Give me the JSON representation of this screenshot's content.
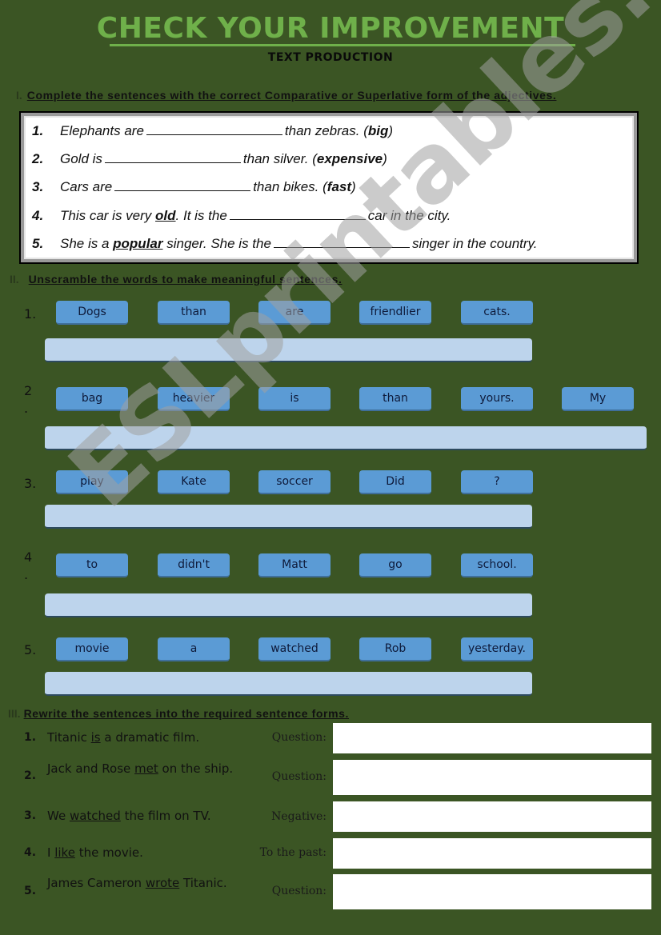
{
  "header": {
    "title": "CHECK YOUR IMPROVEMENT",
    "subtitle": "TEXT PRODUCTION"
  },
  "section1": {
    "number": "I.",
    "instruction": "Complete the sentences with the correct Comparative or Superlative form of the adjectives.",
    "items": [
      {
        "num": "1.",
        "before": "Elephants are",
        "after": "than zebras. (",
        "hint": "big",
        "close": ")"
      },
      {
        "num": "2.",
        "before": "Gold is",
        "after": "than silver. (",
        "hint": "expensive",
        "close": ")"
      },
      {
        "num": "3.",
        "before": "Cars are",
        "after": "than bikes. (",
        "hint": "fast",
        "close": ")"
      },
      {
        "num": "4.",
        "pre": "This car is very ",
        "keyword": "old",
        "before": ". It is the",
        "after": "car in the city."
      },
      {
        "num": "5.",
        "pre": "She is a ",
        "keyword": "popular",
        "before": " singer. She is the",
        "after": "singer in the country."
      }
    ]
  },
  "section2": {
    "number": "II.",
    "instruction": "Unscramble the words to make meaningful sentences.",
    "items": [
      {
        "num": "1.",
        "words": [
          "Dogs",
          "than",
          "are",
          "friendlier",
          "cats."
        ]
      },
      {
        "num": "2\n.",
        "words": [
          "bag",
          "heavier",
          "is",
          "than",
          "yours.",
          "My"
        ]
      },
      {
        "num": "3.",
        "words": [
          "play",
          "Kate",
          "soccer",
          "Did",
          "?"
        ]
      },
      {
        "num": "4\n.",
        "words": [
          "to",
          "didn't",
          "Matt",
          "go",
          "school."
        ]
      },
      {
        "num": "5.",
        "words": [
          "movie",
          "a",
          "watched",
          "Rob",
          "yesterday."
        ]
      }
    ]
  },
  "section3": {
    "number": "III.",
    "instruction": "Rewrite the sentences into the required sentence forms.",
    "items": [
      {
        "num": "1.",
        "pre": "Titanic ",
        "keyword": "is",
        "post": " a dramatic film.",
        "label": "Question:"
      },
      {
        "num": "2.",
        "pre": "Jack and Rose ",
        "keyword": "met",
        "post": " on the ship.",
        "label": "Question:"
      },
      {
        "num": "3.",
        "pre": "We ",
        "keyword": "watched",
        "post": " the film on TV.",
        "label": "Negative:"
      },
      {
        "num": "4.",
        "pre": "I ",
        "keyword": "like",
        "post": " the movie.",
        "label": "To the past:"
      },
      {
        "num": "5.",
        "pre": "James Cameron ",
        "keyword": "wrote",
        "post": " Titanic.",
        "label": "Question:"
      }
    ]
  },
  "watermark": "ESLprintables.com",
  "colors": {
    "background": "#3b5524",
    "title": "#6fb04a",
    "word_card": "#5b9bd5",
    "answer_strip": "#bdd4ec"
  }
}
